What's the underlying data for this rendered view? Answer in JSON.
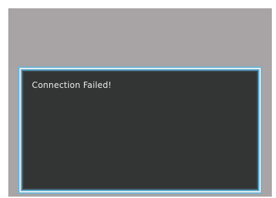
{
  "dialog": {
    "message": "Connection Failed!"
  },
  "colors": {
    "background": "#a9a4a6",
    "dialog_fill": "#333534",
    "dialog_border": "#6fb4d4",
    "text": "#ededed"
  }
}
